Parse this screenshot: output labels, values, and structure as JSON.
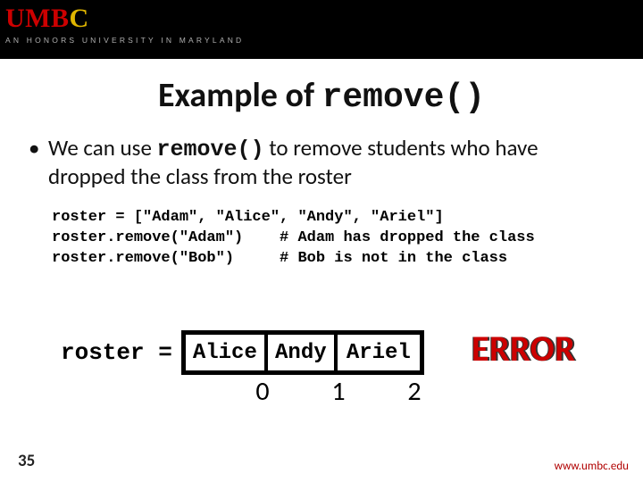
{
  "banner": {
    "logo_umb": "UMB",
    "logo_c": "C",
    "tagline": "AN HONORS UNIVERSITY IN MARYLAND"
  },
  "title": {
    "pre": "Example of ",
    "code": "remove()"
  },
  "bullet": {
    "pre": "We can use ",
    "code": "remove()",
    "post": " to remove students who have dropped the class from the roster"
  },
  "code": {
    "line1": "roster = [\"Adam\", \"Alice\", \"Andy\", \"Ariel\"]",
    "line2": "roster.remove(\"Adam\")    # Adam has dropped the class",
    "line3": "roster.remove(\"Bob\")     # Bob is not in the class"
  },
  "roster": {
    "label": "roster = ",
    "cells": [
      "Alice",
      "Andy",
      "Ariel"
    ],
    "indices": [
      "0",
      "1",
      "2"
    ]
  },
  "error_label": "ERROR",
  "page_number": "35",
  "footer_url": "www.umbc.edu"
}
